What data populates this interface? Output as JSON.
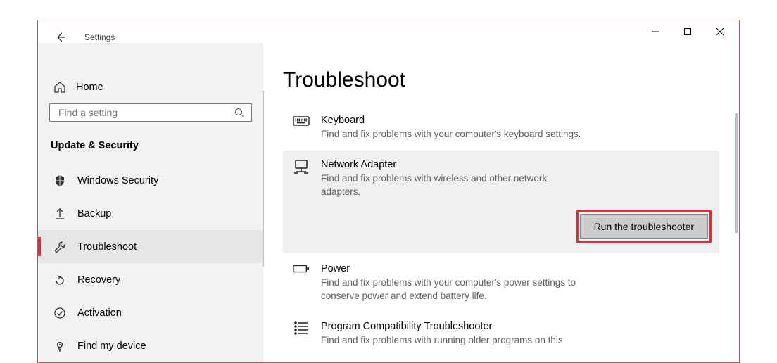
{
  "app_title": "Settings",
  "sidebar": {
    "home_label": "Home",
    "search_placeholder": "Find a setting",
    "category": "Update & Security",
    "items": [
      {
        "id": "windows-security",
        "label": "Windows Security"
      },
      {
        "id": "backup",
        "label": "Backup"
      },
      {
        "id": "troubleshoot",
        "label": "Troubleshoot"
      },
      {
        "id": "recovery",
        "label": "Recovery"
      },
      {
        "id": "activation",
        "label": "Activation"
      },
      {
        "id": "find-my-device",
        "label": "Find my device"
      }
    ],
    "selected": "troubleshoot"
  },
  "main": {
    "title": "Troubleshoot",
    "run_label": "Run the troubleshooter",
    "items": [
      {
        "id": "keyboard",
        "title": "Keyboard",
        "desc": "Find and fix problems with your computer's keyboard settings."
      },
      {
        "id": "network-adapter",
        "title": "Network Adapter",
        "desc": "Find and fix problems with wireless and other network adapters."
      },
      {
        "id": "power",
        "title": "Power",
        "desc": "Find and fix problems with your computer's power settings to conserve power and extend battery life."
      },
      {
        "id": "program-compatibility",
        "title": "Program Compatibility Troubleshooter",
        "desc": "Find and fix problems with running older programs on this"
      }
    ],
    "selected": "network-adapter"
  }
}
